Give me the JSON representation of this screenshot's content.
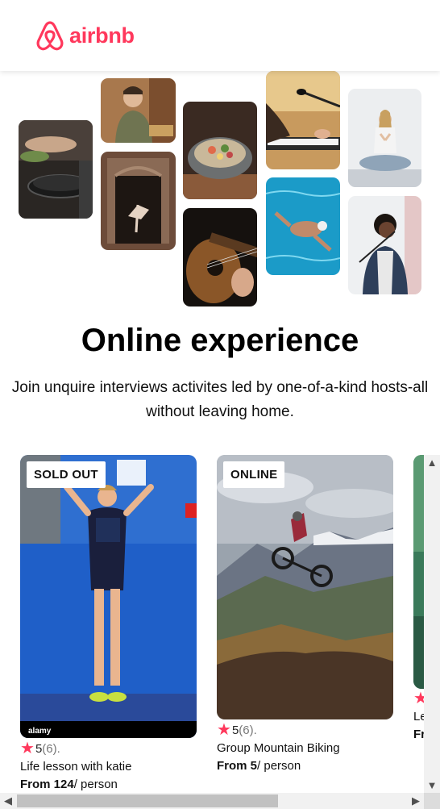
{
  "brand": {
    "name": "airbnb",
    "color": "#FF385C"
  },
  "collage": {
    "icon_names": [
      "cooking-photo",
      "baker-photo",
      "dancer-photo",
      "food-bowl-photo",
      "guitar-photo",
      "keyboard-player-photo",
      "swimmer-photo",
      "yoga-photo",
      "singer-photo"
    ]
  },
  "hero": {
    "title": "Online experience",
    "subtitle_line1": "Join unquire interviews activites led by one-of-a-kind hosts-all",
    "subtitle_line2": "without leaving home."
  },
  "cards": [
    {
      "badge": "SOLD OUT",
      "rating": "5",
      "reviews": "(6).",
      "title": "Life lesson with katie",
      "price_prefix": "From 124",
      "price_suffix": "/ person"
    },
    {
      "badge": "ONLINE",
      "rating": "5",
      "reviews": "(6).",
      "title": "Group Mountain Biking",
      "price_prefix": "From 5",
      "price_suffix": "/ person"
    },
    {
      "title": "Le",
      "price_prefix": "Fr"
    }
  ],
  "scrollbars": {
    "up": "▲",
    "down": "▼",
    "left": "◀",
    "right": "▶"
  }
}
